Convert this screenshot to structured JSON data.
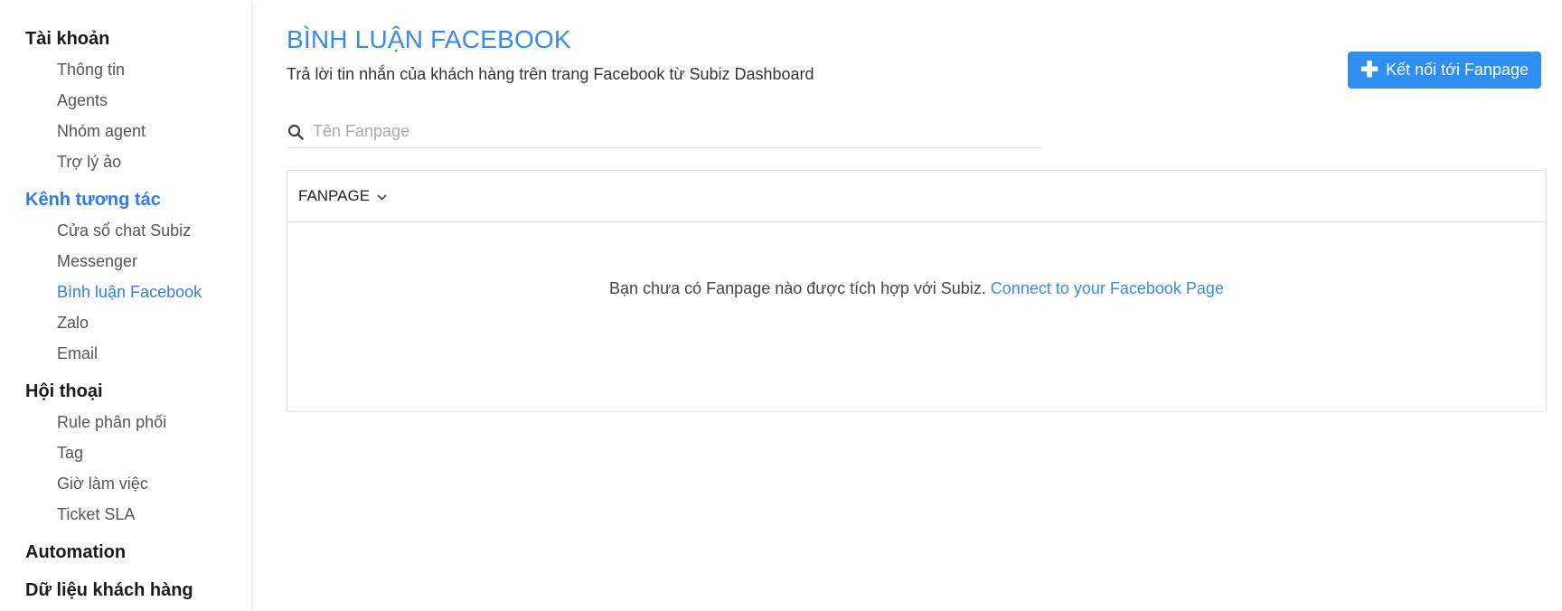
{
  "sidebar": {
    "sections": [
      {
        "heading": "Tài khoản",
        "items": [
          "Thông tin",
          "Agents",
          "Nhóm agent",
          "Trợ lý ảo"
        ]
      },
      {
        "heading": "Kênh tương tác",
        "items": [
          "Cửa sổ chat Subiz",
          "Messenger",
          "Bình luận Facebook",
          "Zalo",
          "Email"
        ]
      },
      {
        "heading": "Hội thoại",
        "items": [
          "Rule phân phối",
          "Tag",
          "Giờ làm việc",
          "Ticket SLA"
        ]
      },
      {
        "heading": "Automation",
        "items": []
      },
      {
        "heading": "Dữ liệu khách hàng",
        "items": []
      }
    ],
    "active_section": "Kênh tương tác",
    "active_item": "Bình luận Facebook"
  },
  "main": {
    "title": "BÌNH LUẬN FACEBOOK",
    "subtitle": "Trả lời tin nhắn của khách hàng trên trang Facebook từ Subiz Dashboard",
    "connect_button": {
      "label": "Kết nối tới Fanpage",
      "icon": "plus-icon"
    },
    "search": {
      "placeholder": "Tên Fanpage",
      "value": "",
      "icon": "search-icon"
    },
    "table": {
      "column": "FANPAGE",
      "column_icon": "chevron-down-icon",
      "empty_text": "Bạn chưa có Fanpage nào được tích hợp với Subiz.",
      "empty_link": "Connect to your Facebook Page"
    }
  },
  "colors": {
    "accent": "#3b8ae6",
    "button": "#2f8ff0"
  }
}
